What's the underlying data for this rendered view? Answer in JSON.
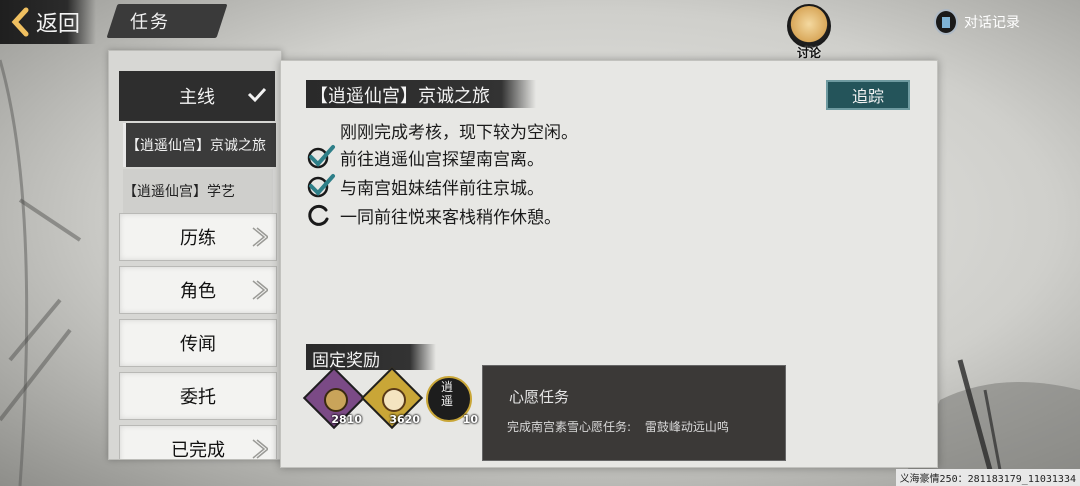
{
  "header": {
    "back_label": "返回",
    "page_title": "任务",
    "discuss_label": "讨论",
    "dialog_log_label": "对话记录"
  },
  "categories": {
    "main_label": "主线",
    "sub_items": [
      {
        "label": "【逍遥仙宫】京诚之旅"
      },
      {
        "label": "【逍遥仙宫】学艺"
      }
    ],
    "buttons": [
      {
        "label": "历练"
      },
      {
        "label": "角色"
      },
      {
        "label": "传闻"
      },
      {
        "label": "委托"
      },
      {
        "label": "已完成"
      }
    ]
  },
  "quest": {
    "title": "【逍遥仙宫】京诚之旅",
    "track_label": "追踪",
    "description": "刚刚完成考核，现下较为空闲。",
    "steps": [
      {
        "text": "前往逍遥仙宫探望南宫离。",
        "status": "done"
      },
      {
        "text": "与南宫姐妹结伴前往京城。",
        "status": "done"
      },
      {
        "text": "一同前往悦来客栈稍作休憩。",
        "status": "in-progress"
      }
    ]
  },
  "rewards": {
    "title": "固定奖励",
    "items": [
      {
        "count": "2810",
        "color": "#7b4a86"
      },
      {
        "count": "3620",
        "color": "#c9a637"
      },
      {
        "count": "10",
        "color": "#1d1d1d",
        "glyph": "逍遥"
      }
    ]
  },
  "wish_popup": {
    "title": "心愿任务",
    "desc_label": "完成南宫素雪心愿任务:",
    "desc_value": "雷鼓峰动远山鸣"
  },
  "footer": {
    "player_id": "义海豪情250：281183179_11031334"
  },
  "colors": {
    "accent": "#24545a",
    "dark_bar": "#2e2e2e",
    "panel": "#e7e7e4"
  }
}
